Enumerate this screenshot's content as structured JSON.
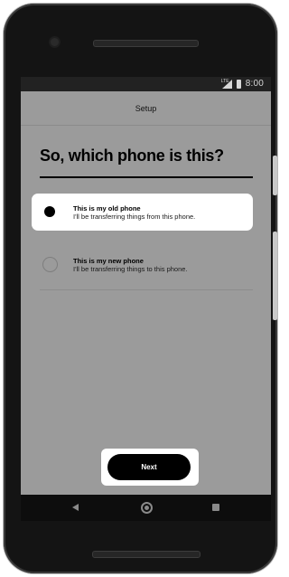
{
  "status_bar": {
    "network": "LTE",
    "time": "8:00"
  },
  "header": {
    "title": "Setup"
  },
  "page": {
    "title": "So, which phone is this?"
  },
  "options": [
    {
      "title": "This is my old phone",
      "subtitle": "I'll be transferring things from this phone.",
      "selected": true
    },
    {
      "title": "This is my new phone",
      "subtitle": "I'll be transferring things to this phone.",
      "selected": false
    }
  ],
  "footer": {
    "next_label": "Next"
  },
  "nav_bar": {
    "icons": [
      "back-icon",
      "home-icon",
      "recents-icon"
    ]
  },
  "colors": {
    "screen_background": "#9b9b9b",
    "accent": "#000000",
    "selected_card": "#ffffff"
  }
}
